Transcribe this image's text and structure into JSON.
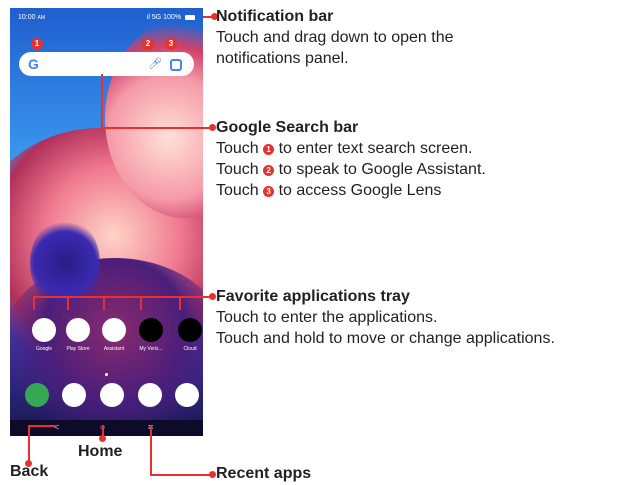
{
  "status_bar": {
    "time": "10:00",
    "time_suffix": "AM",
    "network": "5G",
    "battery": "100%"
  },
  "search_bar": {
    "g_logo": "G",
    "mic_icon": "mic-icon",
    "lens_icon": "lens-icon"
  },
  "markers": [
    "1",
    "2",
    "3"
  ],
  "favorites": [
    {
      "label": "Google",
      "icon": "google-apps-icon",
      "color": "#ffffff"
    },
    {
      "label": "Play Store",
      "icon": "play-store-icon",
      "color": "#ffffff"
    },
    {
      "label": "Assistant",
      "icon": "assistant-icon",
      "color": "#ffffff"
    },
    {
      "label": "My Veriz...",
      "icon": "verizon-icon",
      "color": "#000000"
    },
    {
      "label": "Cloud",
      "icon": "cloud-icon",
      "color": "#000000"
    }
  ],
  "dock": [
    {
      "icon": "phone-icon",
      "color": "#34a853"
    },
    {
      "icon": "messages-icon",
      "color": "#ffffff"
    },
    {
      "icon": "chrome-icon",
      "color": "#ffffff"
    },
    {
      "icon": "photos-icon",
      "color": "#ffffff"
    },
    {
      "icon": "camera-icon",
      "color": "#ffffff"
    }
  ],
  "nav_bar": {
    "back": "<",
    "home": "○",
    "recents": "≡"
  },
  "annotations": {
    "notification_bar": {
      "title": "Notification bar",
      "lines": [
        "Touch and drag down to open the",
        "notifications panel."
      ]
    },
    "google_search_bar": {
      "title": "Google Search bar",
      "lines": [
        {
          "prefix": "Touch",
          "marker": "1",
          "suffix": "to enter text search screen."
        },
        {
          "prefix": "Touch",
          "marker": "2",
          "suffix": "to speak to Google Assistant."
        },
        {
          "prefix": "Touch",
          "marker": "3",
          "suffix": "to access Google Lens"
        }
      ]
    },
    "favorite_tray": {
      "title": "Favorite applications tray",
      "lines": [
        "Touch to enter the applications.",
        "Touch and hold to move or change applications."
      ]
    },
    "recent_apps": {
      "title": "Recent apps"
    },
    "home": {
      "title": "Home"
    },
    "back": {
      "title": "Back"
    }
  }
}
